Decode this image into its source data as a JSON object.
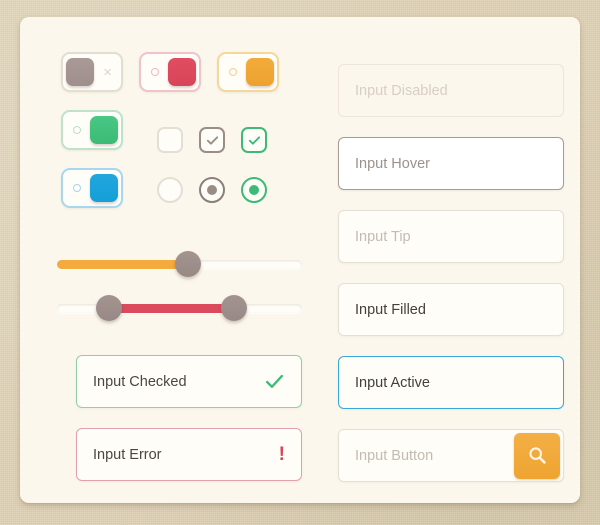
{
  "panel": {
    "background_color": "#fbf7ec",
    "page_background_color": "#ded1b4"
  },
  "toggles": [
    {
      "id": "toggle-gray",
      "state": "off",
      "label": "toggle-switch-off-gray",
      "mark": "×",
      "color": "#a99a97"
    },
    {
      "id": "toggle-red",
      "state": "on",
      "label": "toggle-switch-on-red",
      "mark": "",
      "color": "#dc4a5e"
    },
    {
      "id": "toggle-orange",
      "state": "on",
      "label": "toggle-switch-on-orange",
      "mark": "",
      "color": "#f2ab3c"
    },
    {
      "id": "toggle-green",
      "state": "on",
      "label": "toggle-switch-on-green",
      "mark": "",
      "color": "#3cba76"
    },
    {
      "id": "toggle-blue",
      "state": "on",
      "label": "toggle-switch-on-blue",
      "mark": "",
      "color": "#1ba2da"
    }
  ],
  "checkboxes": [
    {
      "id": "cb-empty",
      "checked": false,
      "color": "#e5ded3"
    },
    {
      "id": "cb-gray",
      "checked": true,
      "color": "#9a8d86"
    },
    {
      "id": "cb-green",
      "checked": true,
      "color": "#3cba76"
    }
  ],
  "radios": [
    {
      "id": "rd-empty",
      "selected": false,
      "color": "#e5ded3"
    },
    {
      "id": "rd-gray",
      "selected": true,
      "color": "#9a8d86"
    },
    {
      "id": "rd-green",
      "selected": true,
      "color": "#3cba76"
    }
  ],
  "sliders": [
    {
      "id": "slider-single",
      "type": "single",
      "value": 54,
      "min": 0,
      "max": 100,
      "fill_color": "#f2ab3c"
    },
    {
      "id": "slider-range",
      "type": "range",
      "value_low": 22,
      "value_high": 73,
      "min": 0,
      "max": 100,
      "fill_color": "#dc4a5e"
    }
  ],
  "inputs": {
    "checked": {
      "value": "Input Checked",
      "state": "checked",
      "icon": "check-icon",
      "accent": "#3cba76"
    },
    "error": {
      "value": "Input Error",
      "state": "error",
      "icon": "exclamation-icon",
      "icon_glyph": "!",
      "accent": "#d6455b"
    },
    "disabled": {
      "value": "Input Disabled",
      "state": "disabled",
      "accent": "#d7cfc4"
    },
    "hover": {
      "value": "Input Hover",
      "state": "hover",
      "accent": "#a79c93"
    },
    "tip": {
      "value": "Input Tip",
      "state": "tip",
      "accent": "#c3bbb2"
    },
    "filled": {
      "value": "Input Filled",
      "state": "filled",
      "accent": "#433f3d"
    },
    "active": {
      "value": "Input Active",
      "state": "active",
      "accent": "#3aa7d8"
    },
    "button": {
      "value": "Input Button",
      "state": "button",
      "icon": "search-icon",
      "accent": "#f2ab3c"
    }
  }
}
